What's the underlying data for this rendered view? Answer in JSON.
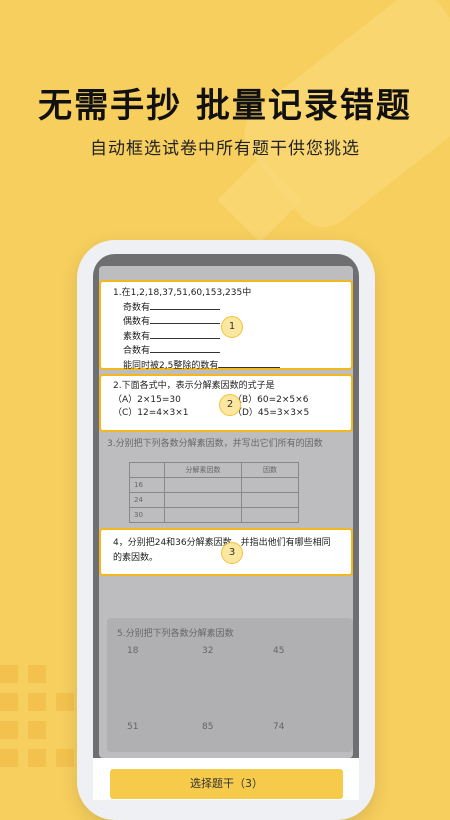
{
  "headline": "无需手抄  批量记录错题",
  "subline": "自动框选试卷中所有题干供您挑选",
  "q1": {
    "title": "1.在1,2,18,37,51,60,153,235中",
    "items": [
      "奇数有",
      "偶数有",
      "素数有",
      "合数有",
      "能同时被2,5整除的数有"
    ],
    "badge": "1"
  },
  "q2": {
    "title": "2.下面各式中，表示分解素因数的式子是",
    "opt_a": "（A）2×15=30",
    "opt_b": "（B）60=2×5×6",
    "opt_c": "（C）12=4×3×1",
    "opt_d": "（D）45=3×3×5",
    "badge": "2"
  },
  "q3": {
    "title": "3.分别把下列各数分解素因数，并写出它们所有的因数",
    "headers": [
      "",
      "分解素因数",
      "因数"
    ],
    "rows": [
      "16",
      "24",
      "30"
    ]
  },
  "q4": {
    "line1": "4，分别把24和36分解素因数，并指出他们有哪些相同",
    "line2": "的素因数。",
    "badge": "3"
  },
  "q5": {
    "title": "5.分别把下列各数分解素因数",
    "numbers": [
      "18",
      "32",
      "45",
      "51",
      "85",
      "74"
    ]
  },
  "select_button": "选择题干（3）"
}
